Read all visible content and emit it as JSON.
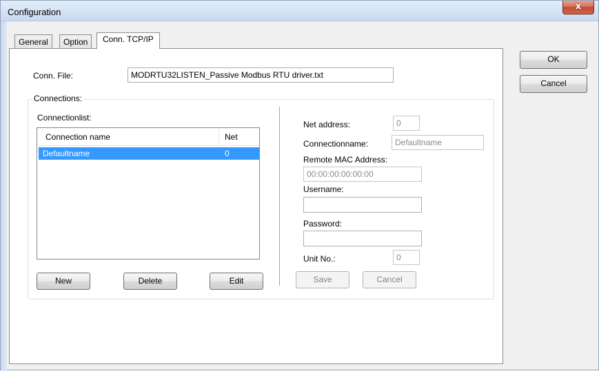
{
  "window": {
    "title": "Configuration",
    "close_glyph": "x"
  },
  "tabs": [
    {
      "label": "General"
    },
    {
      "label": "Option"
    },
    {
      "label": "Conn. TCP/IP",
      "active": true
    }
  ],
  "dialog_buttons": {
    "ok": "OK",
    "cancel": "Cancel"
  },
  "conn_file": {
    "label": "Conn. File:",
    "value": "MODRTU32LISTEN_Passive Modbus RTU driver.txt"
  },
  "connections": {
    "group_title": "Connections:",
    "list_label": "Connectionlist:",
    "columns": [
      "Connection name",
      "Net"
    ],
    "rows": [
      {
        "name": "Defaultname",
        "net": "0",
        "selected": true
      }
    ],
    "buttons": {
      "new": "New",
      "delete": "Delete",
      "edit": "Edit"
    }
  },
  "details": {
    "net_address_label": "Net address:",
    "net_address_value": "0",
    "connectionname_label": "Connectionname:",
    "connectionname_value": "Defaultname",
    "remote_mac_label": "Remote MAC Address:",
    "remote_mac_value": "00:00:00:00:00:00",
    "username_label": "Username:",
    "username_value": "",
    "password_label": "Password:",
    "password_value": "",
    "unit_no_label": "Unit No.:",
    "unit_no_value": "0",
    "save_label": "Save",
    "cancel_label": "Cancel"
  },
  "colors": {
    "selection": "#3399ff",
    "close_button": "#c24b30"
  }
}
